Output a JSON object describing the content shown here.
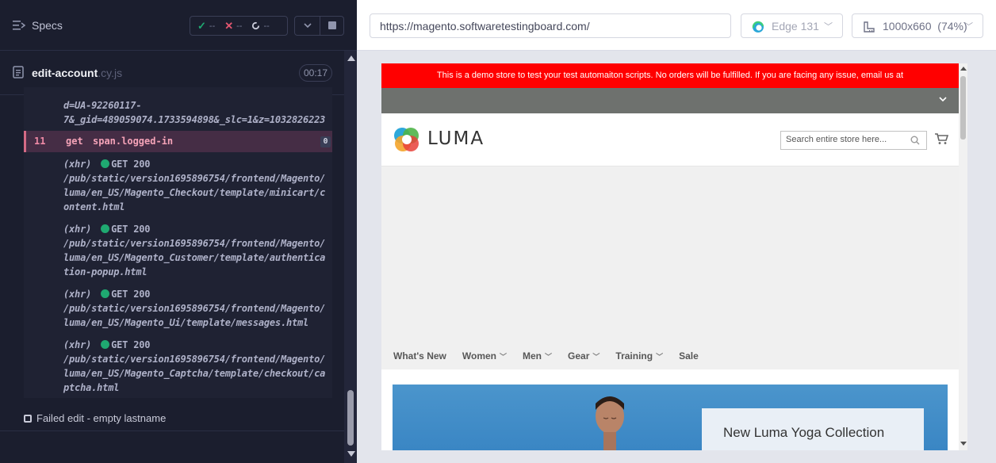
{
  "runner": {
    "specs_label": "Specs",
    "stats": {
      "passed": "--",
      "failed": "--",
      "pending": "--"
    },
    "spec_name": "edit-account",
    "spec_ext": ".cy.js",
    "timer": "00:17",
    "colors": {
      "pass": "#1fa971",
      "fail": "#e45770",
      "background": "#1b1e2e"
    }
  },
  "command_log": {
    "top_lines": [
      "d=UA-92260117-",
      "7&_gid=489059074.1733594898&_slc=1&z=1032826223"
    ],
    "active_command": {
      "number": "11",
      "name": "get",
      "selector": "span.logged-in",
      "badge": "0"
    },
    "xhr_entries": [
      {
        "tag": "(xhr)",
        "method": "GET 200",
        "lines": [
          "/pub/static/version1695896754/frontend/Magento/",
          "luma/en_US/Magento_Checkout/template/minicart/c",
          "ontent.html"
        ]
      },
      {
        "tag": "(xhr)",
        "method": "GET 200",
        "lines": [
          "/pub/static/version1695896754/frontend/Magento/",
          "luma/en_US/Magento_Customer/template/authentica",
          "tion-popup.html"
        ]
      },
      {
        "tag": "(xhr)",
        "method": "GET 200",
        "lines": [
          "/pub/static/version1695896754/frontend/Magento/",
          "luma/en_US/Magento_Ui/template/messages.html"
        ]
      },
      {
        "tag": "(xhr)",
        "method": "GET 200",
        "lines": [
          "/pub/static/version1695896754/frontend/Magento/",
          "luma/en_US/Magento_Captcha/template/checkout/ca",
          "ptcha.html"
        ]
      }
    ],
    "next_test": "Failed edit - empty lastname"
  },
  "browser": {
    "url": "https://magento.softwaretestingboard.com/",
    "browser_name": "Edge 131",
    "viewport": "1000x660",
    "zoom": "(74%)"
  },
  "aut": {
    "demo_banner": "This is a demo store to test your test automaiton scripts. No orders will be fulfilled. If you are facing any issue, email us at hello@softwaretestingboard.com.",
    "logo": "LUMA",
    "search_placeholder": "Search entire store here...",
    "nav": [
      "What's New",
      "Women",
      "Men",
      "Gear",
      "Training",
      "Sale"
    ],
    "promo_title": "New Luma Yoga Collection",
    "colors": {
      "banner": "#ff0000",
      "bar": "#6e716e"
    }
  }
}
